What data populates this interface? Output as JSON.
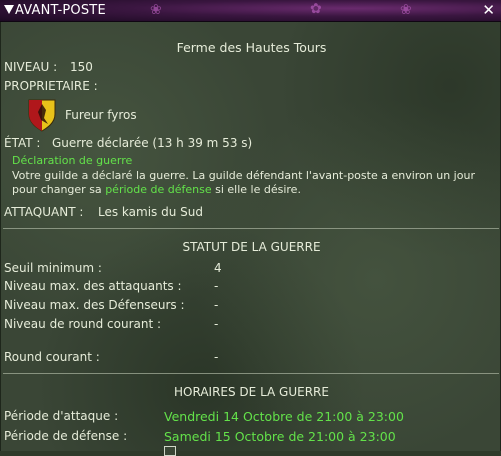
{
  "window": {
    "title": "AVANT-POSTE"
  },
  "outpost": {
    "name": "Ferme des Hautes Tours",
    "level_label": "NIVEAU :",
    "level_value": "150",
    "owner_label": "PROPRIETAIRE :",
    "owner_guild": "Fureur fyros",
    "state_label": "ÉTAT :",
    "state_value": "Guerre déclarée (13 h 39 m 53 s)",
    "declaration_title": "Déclaration de guerre",
    "declaration_line1": "Votre guilde a déclaré la guerre. La guilde défendant l'avant-poste a environ un jour",
    "declaration_line2_pre": "pour changer sa ",
    "declaration_link": "période de défense",
    "declaration_line2_post": " si elle le désire.",
    "attacker_label": "ATTAQUANT :",
    "attacker_value": "Les kamis du Sud"
  },
  "war_status": {
    "heading": "STATUT DE LA GUERRE",
    "rows": [
      {
        "label": "Seuil minimum :",
        "value": "4"
      },
      {
        "label": "Niveau max. des attaquants :",
        "value": "-"
      },
      {
        "label": "Niveau max. des Défenseurs :",
        "value": "-"
      },
      {
        "label": "Niveau de round courant :",
        "value": "-"
      },
      {
        "label": "Round courant :",
        "value": "-"
      }
    ]
  },
  "war_schedule": {
    "heading": "HORAIRES DE LA GUERRE",
    "rows": [
      {
        "label": "Période d'attaque :",
        "value": "Vendredi 14 Octobre de 21:00 à 23:00"
      },
      {
        "label": "Période de défense :",
        "value": "Samedi 15 Octobre de 21:00 à 23:00"
      }
    ]
  },
  "colors": {
    "title_bar": "#3a1640",
    "background": "#3a4636",
    "accent_green": "#63e24a",
    "shield_red": "#b0171b",
    "shield_gold": "#e8c21a"
  }
}
